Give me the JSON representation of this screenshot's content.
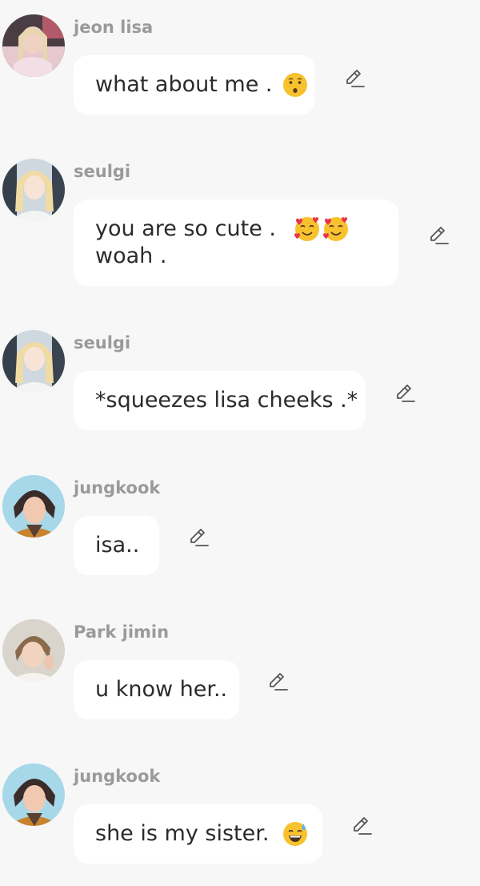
{
  "messages": [
    {
      "sender": "jeon lisa",
      "avatar": "avatar-lisa",
      "lines": [
        "what about me ."
      ],
      "emojis": [
        "kissing-face-emoji"
      ]
    },
    {
      "sender": "seulgi",
      "avatar": "avatar-seulgi",
      "lines": [
        "you are so cute .",
        "woah ."
      ],
      "emojis": [
        "smiling-face-with-hearts-emoji",
        "smiling-face-with-hearts-emoji"
      ]
    },
    {
      "sender": "seulgi",
      "avatar": "avatar-seulgi",
      "lines": [
        "*squeezes lisa cheeks .*"
      ],
      "emojis": []
    },
    {
      "sender": "jungkook",
      "avatar": "avatar-jungkook",
      "lines": [
        "isa.."
      ],
      "emojis": []
    },
    {
      "sender": "Park jimin",
      "avatar": "avatar-jimin",
      "lines": [
        "u know her.."
      ],
      "emojis": []
    },
    {
      "sender": "jungkook",
      "avatar": "avatar-jungkook",
      "lines": [
        "she is my sister."
      ],
      "emojis": [
        "grinning-face-with-sweat-emoji"
      ]
    }
  ],
  "icons": {
    "edit": "pencil-edit-icon"
  },
  "colors": {
    "background": "#f7f7f7",
    "bubble": "#ffffff",
    "sender_text": "#9a9a9a",
    "message_text": "#2b2b2b"
  }
}
